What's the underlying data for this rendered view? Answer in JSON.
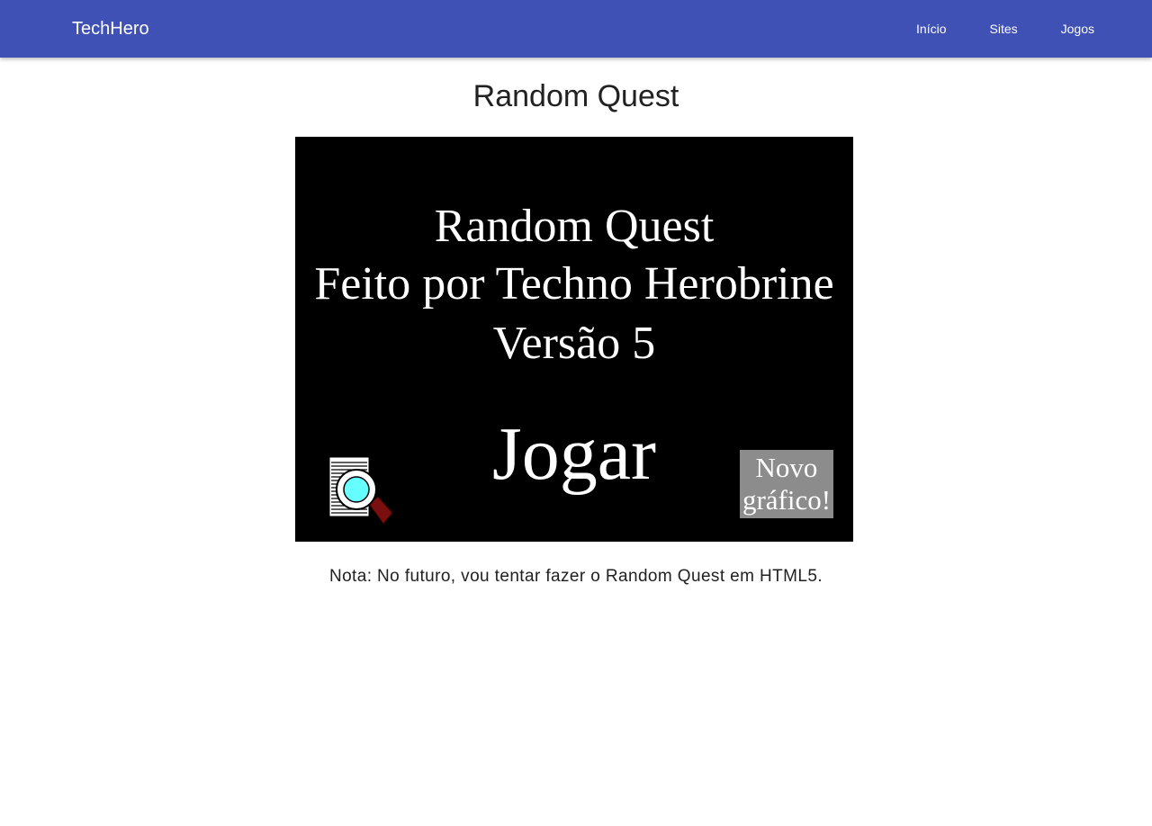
{
  "navbar": {
    "brand": "TechHero",
    "links": [
      {
        "label": "Início"
      },
      {
        "label": "Sites"
      },
      {
        "label": "Jogos"
      }
    ],
    "color": "#3f51b5"
  },
  "page": {
    "title": "Random Quest"
  },
  "game": {
    "title_line": "Random Quest",
    "author_line": "Feito por Techno Herobrine",
    "version_line": "Versão 5",
    "play_label": "Jogar",
    "new_graphics_line1": "Novo",
    "new_graphics_line2": "gráfico!",
    "inspect_icon": "document-magnifier-icon",
    "background": "#000000"
  },
  "note": "Nota: No futuro, vou tentar fazer o Random Quest em HTML5."
}
